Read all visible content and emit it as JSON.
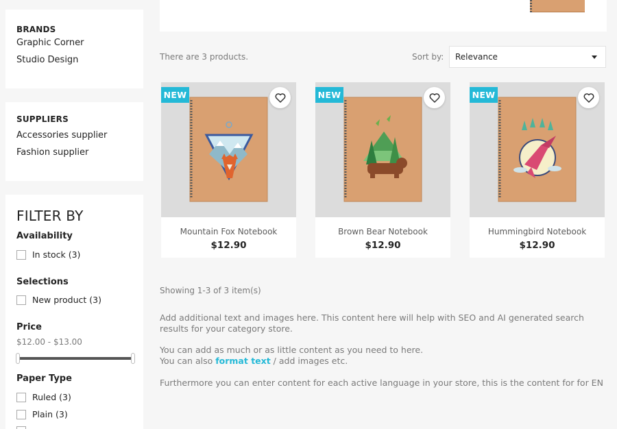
{
  "sidebar": {
    "brands": {
      "title": "BRANDS",
      "items": [
        "Graphic Corner",
        "Studio Design"
      ]
    },
    "suppliers": {
      "title": "SUPPLIERS",
      "items": [
        "Accessories supplier",
        "Fashion supplier"
      ]
    },
    "filters": {
      "title": "FILTER BY",
      "availability": {
        "title": "Availability",
        "options": [
          "In stock (3)"
        ]
      },
      "selections": {
        "title": "Selections",
        "options": [
          "New product (3)"
        ]
      },
      "price": {
        "title": "Price",
        "range": "$12.00 - $13.00"
      },
      "paper_type": {
        "title": "Paper Type",
        "options": [
          "Ruled (3)",
          "Plain (3)"
        ]
      }
    }
  },
  "listing": {
    "count_text": "There are 3 products.",
    "sort_label": "Sort by:",
    "sort_value": "Relevance",
    "showing": "Showing 1-3 of 3 item(s)"
  },
  "products": [
    {
      "name": "Mountain Fox Notebook",
      "price": "$12.90",
      "badge": "NEW"
    },
    {
      "name": "Brown Bear Notebook",
      "price": "$12.90",
      "badge": "NEW"
    },
    {
      "name": "Hummingbird Notebook",
      "price": "$12.90",
      "badge": "NEW"
    }
  ],
  "description": {
    "p1": "Add additional text and images here. This content here will help with SEO and AI generated search results for your category store.",
    "p2_line1": "You can add as much or as little content as you need to here.",
    "p2_line2_prefix": "You can also ",
    "p2_link": "format text",
    "p2_line2_suffix": " / add images etc.",
    "p3": "Furthermore you can enter content for each active language in your store, this is the content for for EN"
  },
  "colors": {
    "accent": "#24b9d7",
    "notebook_cover": "#d9a071",
    "background": "#f6f6f6"
  },
  "icons": {
    "wishlist": "heart-outline-icon",
    "sort_caret": "caret-down-icon"
  }
}
